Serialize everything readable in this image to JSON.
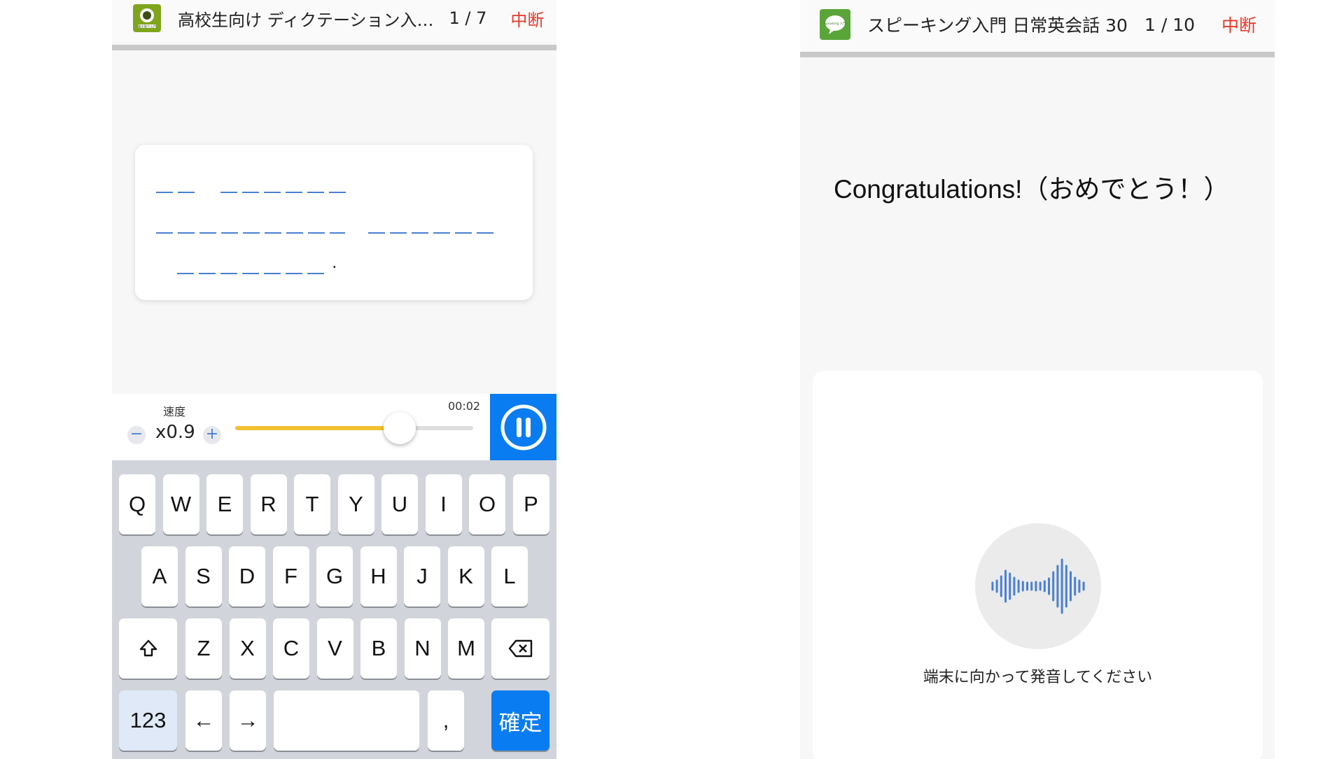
{
  "left_screen": {
    "app_icon": "listen-book-icon",
    "app_icon_color": "#7fa51c",
    "app_icon_caption": "聞き取り入門",
    "title": "高校生向け ディクテーション入…",
    "counter": "1 / 7",
    "stop_label": "中断",
    "stop_color": "#e53b2c",
    "period": ".",
    "player": {
      "speed_label": "速度",
      "minus_label": "−",
      "plus_label": "+",
      "speed_value": "x0.9",
      "elapsed": "00:02",
      "playback_progress": 0.69,
      "pause_icon": "pause-icon",
      "accent_color": "#0a7cf2",
      "slider_color": "#f2c12e"
    },
    "keyboard": {
      "row1": [
        "Q",
        "W",
        "E",
        "R",
        "T",
        "Y",
        "U",
        "I",
        "O",
        "P"
      ],
      "row2": [
        "A",
        "S",
        "D",
        "F",
        "G",
        "H",
        "J",
        "K",
        "L"
      ],
      "row3": [
        "Z",
        "X",
        "C",
        "V",
        "B",
        "N",
        "M"
      ],
      "shift_icon": "shift-icon",
      "delete_icon": "backspace-icon",
      "numbers_label": "123",
      "left_arrow": "←",
      "right_arrow": "→",
      "comma": ",",
      "confirm_label": "確定"
    }
  },
  "right_screen": {
    "app_icon": "speech-bubble-icon",
    "app_icon_color": "#5aa53a",
    "app_icon_caption": "Speaking 入門",
    "title": "スピーキング入門 日常英会話 30",
    "counter": "1 / 10",
    "stop_label": "中断",
    "sentence": "Congratulations!（おめでとう！）",
    "mic_icon": "voice-waveform-icon",
    "instruction": "端末に向かって発音してください"
  }
}
